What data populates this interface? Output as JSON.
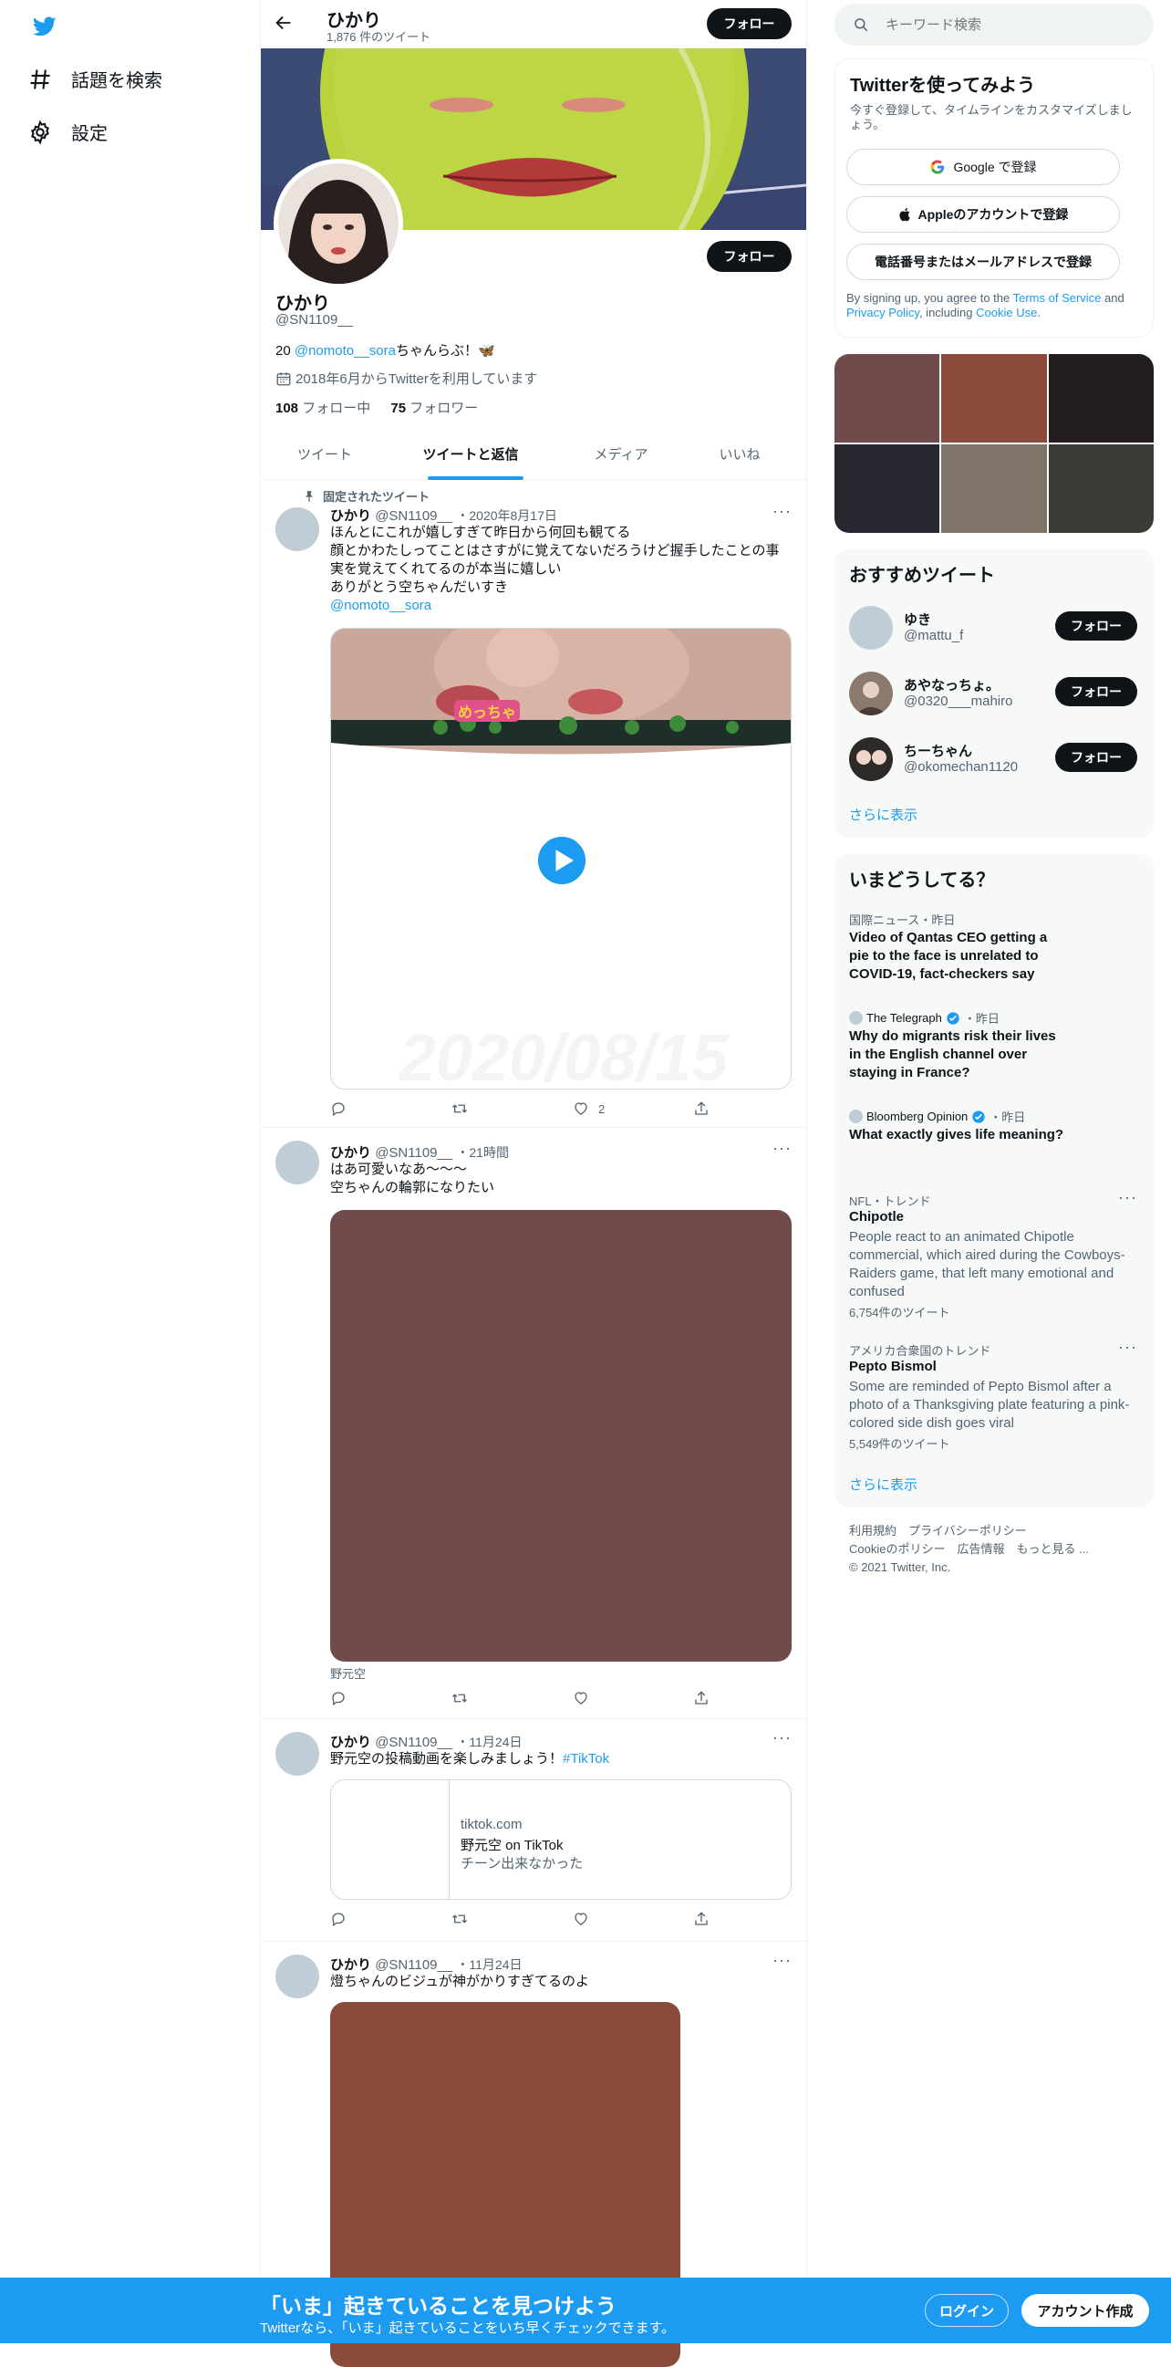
{
  "nav": {
    "search_label": "話題を検索",
    "settings_label": "設定"
  },
  "header": {
    "name": "ひかり",
    "tweet_count": "1,876 件のツイート",
    "follow_label": "フォロー"
  },
  "profile": {
    "name": "ひかり",
    "handle": "@SN1109__",
    "follow_label": "フォロー",
    "bio_prefix": "20 ",
    "bio_mention": "@nomoto__sora",
    "bio_suffix": "ちゃんらぶ！🦋",
    "joined": "2018年6月からTwitterを利用しています",
    "following_count": "108",
    "following_label": "フォロー中",
    "followers_count": "75",
    "followers_label": "フォロワー"
  },
  "tabs": [
    "ツイート",
    "ツイートと返信",
    "メディア",
    "いいね"
  ],
  "tweets": [
    {
      "pinned_label": "固定されたツイート",
      "name": "ひかり",
      "handle": "@SN1109__",
      "time": "・2020年8月17日",
      "lines": [
        "ほんとにこれが嬉しすぎて昨日から何回も観てる",
        "顔とかわたしってことはさすがに覚えてないだろうけど握手したことの事",
        "実を覚えてくれてるのが本当に嬉しい",
        "ありがとう空ちゃんだいすき"
      ],
      "mention": "@nomoto__sora",
      "video_sticker": "めっちゃ",
      "watermark": "2020/08/15",
      "like_count": "2"
    },
    {
      "name": "ひかり",
      "handle": "@SN1109__",
      "time": "・21時間",
      "lines": [
        "はあ可愛いなあ〜〜〜",
        "空ちゃんの輪郭になりたい"
      ],
      "caption": "野元空"
    },
    {
      "name": "ひかり",
      "handle": "@SN1109__",
      "time": "・11月24日",
      "text": "野元空の投稿動画を楽しみましょう！",
      "hashtag": "#TikTok",
      "link": {
        "domain": "tiktok.com",
        "title": "野元空 on TikTok",
        "desc": "チーン出来なかった"
      }
    },
    {
      "name": "ひかり",
      "handle": "@SN1109__",
      "time": "・11月24日",
      "text": "燈ちゃんのビジュが神がかりすぎてるのよ"
    }
  ],
  "search": {
    "placeholder": "キーワード検索"
  },
  "signup": {
    "title": "Twitterを使ってみよう",
    "subtitle": "今すぐ登録して、タイムラインをカスタマイズしましょう。",
    "google": "Google で登録",
    "apple": "Appleのアカウントで登録",
    "phone": "電話番号またはメールアドレスで登録",
    "legal_1": "By signing up, you agree to the ",
    "terms": "Terms of Service",
    "legal_2": " and ",
    "privacy": "Privacy Policy",
    "legal_3": ", including ",
    "cookie": "Cookie Use",
    "legal_4": "."
  },
  "media_grid_colors": [
    "#704b4c",
    "#8a4b3c",
    "#231e1d",
    "#282730",
    "#7e7568",
    "#3a3c35"
  ],
  "suggested": {
    "title": "おすすめツイート",
    "users": [
      {
        "name": "ゆき",
        "handle": "@mattu_f",
        "follow": "フォロー"
      },
      {
        "name": "あやなっちょ。",
        "handle": "@0320___mahiro",
        "follow": "フォロー"
      },
      {
        "name": "ちーちゃん",
        "handle": "@okomechan1120",
        "follow": "フォロー"
      }
    ],
    "more": "さらに表示"
  },
  "trends": {
    "title": "いまどうしてる？",
    "news": [
      {
        "source": "国際ニュース・昨日",
        "title": "Video of Qantas CEO getting a pie to the face is unrelated to COVID-19, fact-checkers say"
      },
      {
        "source": "The Telegraph",
        "time": "・昨日",
        "title": "Why do migrants risk their lives in the English channel over staying in France?"
      },
      {
        "source": "Bloomberg Opinion",
        "time": "・昨日",
        "title": "What exactly gives life meaning?"
      }
    ],
    "items": [
      {
        "context": "NFL・トレンド",
        "name": "Chipotle",
        "desc": "People react to an animated Chipotle commercial, which aired during the Cowboys-Raiders game, that left many emotional and confused",
        "count": "6,754件のツイート"
      },
      {
        "context": "アメリカ合衆国のトレンド",
        "name": "Pepto Bismol",
        "desc": "Some are reminded of Pepto Bismol after a photo of a Thanksgiving plate featuring a pink-colored side dish goes viral",
        "count": "5,549件のツイート"
      }
    ],
    "more": "さらに表示"
  },
  "footer": {
    "line1": "利用規約　プライバシーポリシー",
    "line2": "Cookieのポリシー　広告情報　もっと見る ...",
    "copyright": "© 2021 Twitter, Inc."
  },
  "bottom_bar": {
    "title": "「いま」起きていることを見つけよう",
    "subtitle": "Twitterなら、「いま」起きていることをいち早くチェックできます。",
    "login": "ログイン",
    "signup": "アカウント作成"
  },
  "colors": {
    "accent": "#1d9bf0",
    "bottom_bar": "#1d9bf0",
    "dark": "#0f1419"
  }
}
